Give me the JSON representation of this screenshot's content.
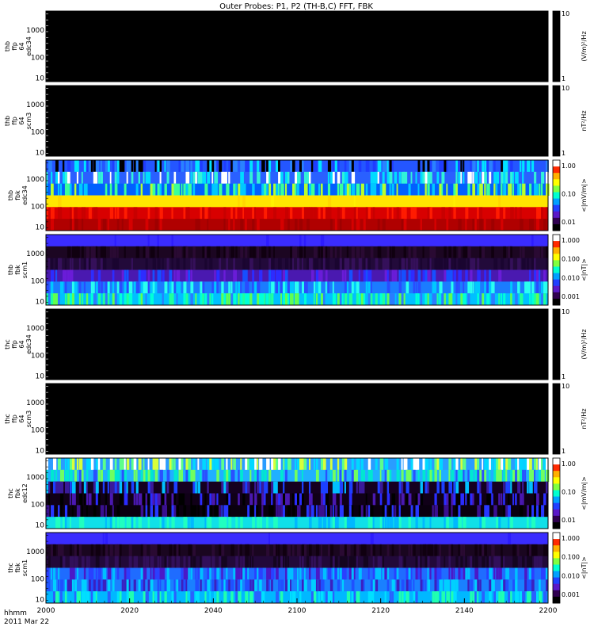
{
  "chart_data": {
    "type": "heatmap",
    "title": "Outer Probes: P1, P2 (TH-B,C) FFT, FBK",
    "xaxis": {
      "header_label": "hhmm",
      "date_label": "2011 Mar 22",
      "ticks": [
        "2000",
        "2020",
        "2040",
        "2100",
        "2120",
        "2140",
        "2200"
      ]
    },
    "panels": [
      {
        "id": "thb-ffp64-edc34",
        "ylabel": [
          "thb",
          "ffp",
          "64",
          "edc34"
        ],
        "yticks": [
          "1000",
          "100",
          "10"
        ],
        "colorbar_label": "(V/m)²/Hz",
        "colorbar_ticks": [
          "10",
          "1"
        ],
        "colorbar_palette": "black",
        "data_state": "no data (all black)"
      },
      {
        "id": "thb-ffp64-scm3",
        "ylabel": [
          "thb",
          "ffp",
          "64",
          "scm3"
        ],
        "yticks": [
          "1000",
          "100",
          "10"
        ],
        "colorbar_label": "nT²/Hz",
        "colorbar_ticks": [
          "10",
          "1"
        ],
        "colorbar_palette": "black",
        "data_state": "no data (all black)"
      },
      {
        "id": "thb-fbk-edc34",
        "ylabel": [
          "thb",
          "fbk",
          "edc34"
        ],
        "yticks": [
          "1000",
          "100",
          "10"
        ],
        "colorbar_label": "<|mV/m|>",
        "colorbar_ticks": [
          "1.00",
          "0.10",
          "0.01"
        ],
        "colorbar_palette": "rainbow",
        "bands": [
          {
            "base": "#2456ff",
            "vary": [
              "#1f3cff",
              "#00e4ff",
              "#2a82ff",
              "#000000"
            ],
            "density": 0.55
          },
          {
            "base": "#2a60ff",
            "vary": [
              "#00dcff",
              "#31f3d8",
              "#ffffff"
            ],
            "density": 0.5
          },
          {
            "base": "#0060ff",
            "vary": [
              "#00c8ff",
              "#3aff9a",
              "#b5ff2f"
            ],
            "density": 0.5
          },
          {
            "base": "#ffe600",
            "vary": [
              "#fff000",
              "#ffd800"
            ],
            "density": 0.05
          },
          {
            "base": "#d80000",
            "vary": [
              "#ff1b00",
              "#c80000"
            ],
            "density": 0.35
          },
          {
            "base": "#b00000",
            "vary": [
              "#d60000",
              "#9e0000"
            ],
            "density": 0.25
          }
        ]
      },
      {
        "id": "thb-fbk-scm1",
        "ylabel": [
          "thb",
          "fbk",
          "scm1"
        ],
        "yticks": [
          "1000",
          "100",
          "10"
        ],
        "colorbar_label": "<|nT|>",
        "colorbar_ticks": [
          "1.000",
          "0.100",
          "0.010",
          "0.001"
        ],
        "colorbar_palette": "rainbow",
        "bands": [
          {
            "base": "#3a2cff",
            "vary": [
              "#2d1cff"
            ],
            "density": 0.05
          },
          {
            "base": "#1c0622",
            "vary": [
              "#2a0a33",
              "#100010"
            ],
            "density": 0.5
          },
          {
            "base": "#220a3a",
            "vary": [
              "#1a0530",
              "#35105a"
            ],
            "density": 0.5
          },
          {
            "base": "#4a19b0",
            "vary": [
              "#2d2cff",
              "#6a1cd8",
              "#1650ff"
            ],
            "density": 0.45
          },
          {
            "base": "#1b7cff",
            "vary": [
              "#00c8ff",
              "#2a4cff",
              "#2afff0"
            ],
            "density": 0.55
          },
          {
            "base": "#00c0ff",
            "vary": [
              "#20ff9c",
              "#60ff50",
              "#00ffd8",
              "#2a7cff"
            ],
            "density": 0.6
          }
        ]
      },
      {
        "id": "thc-ffp64-edc34",
        "ylabel": [
          "thc",
          "ffp",
          "64",
          "edc34"
        ],
        "yticks": [
          "1000",
          "100",
          "10"
        ],
        "colorbar_label": "(V/m)²/Hz",
        "colorbar_ticks": [
          "10",
          "1"
        ],
        "colorbar_palette": "black",
        "data_state": "no data (all black)"
      },
      {
        "id": "thc-ffp64-scm3",
        "ylabel": [
          "thc",
          "ffp",
          "64",
          "scm3"
        ],
        "yticks": [
          "1000",
          "100",
          "10"
        ],
        "colorbar_label": "nT²/Hz",
        "colorbar_ticks": [
          "10",
          "1"
        ],
        "colorbar_palette": "black",
        "data_state": "no data (all black)"
      },
      {
        "id": "thc-fbk-edc12",
        "ylabel": [
          "thc",
          "fbk",
          "edc12"
        ],
        "yticks": [
          "1000",
          "100",
          "10"
        ],
        "colorbar_label": "<|mV/m|>",
        "colorbar_ticks": [
          "1.00",
          "0.10",
          "0.01"
        ],
        "colorbar_palette": "rainbow",
        "bands": [
          {
            "base": "#2a9cff",
            "vary": [
              "#5cff8a",
              "#d8ff3a",
              "#00d8ff",
              "#ffffff"
            ],
            "density": 0.6
          },
          {
            "base": "#20b0ff",
            "vary": [
              "#70ff60",
              "#2a50ff",
              "#00e8d0"
            ],
            "density": 0.6
          },
          {
            "base": "#150020",
            "vary": [
              "#3a1a9a",
              "#1c40ff",
              "#00c0ff"
            ],
            "density": 0.45
          },
          {
            "base": "#100018",
            "vary": [
              "#4a18b0",
              "#2a2cff",
              "#000000"
            ],
            "density": 0.45
          },
          {
            "base": "#0a000f",
            "vary": [
              "#3a1090",
              "#2838ff",
              "#000000"
            ],
            "density": 0.45
          },
          {
            "base": "#10e0e8",
            "vary": [
              "#20ffc0",
              "#00b8ff"
            ],
            "density": 0.35
          }
        ]
      },
      {
        "id": "thc-fbk-scm1",
        "ylabel": [
          "thc",
          "fbk",
          "scm1"
        ],
        "yticks": [
          "1000",
          "100",
          "10"
        ],
        "colorbar_label": "<|nT|>",
        "colorbar_ticks": [
          "1.000",
          "0.100",
          "0.010",
          "0.001"
        ],
        "colorbar_palette": "rainbow",
        "bands": [
          {
            "base": "#3a2cff",
            "vary": [
              "#2d1cff"
            ],
            "density": 0.05
          },
          {
            "base": "#1a0620",
            "vary": [
              "#2a0a33",
              "#100010"
            ],
            "density": 0.5
          },
          {
            "base": "#22093a",
            "vary": [
              "#32105a",
              "#140520"
            ],
            "density": 0.5
          },
          {
            "base": "#1f6cff",
            "vary": [
              "#00c0ff",
              "#4a18c8",
              "#2a40ff"
            ],
            "density": 0.55
          },
          {
            "base": "#1a80ff",
            "vary": [
              "#00d0ff",
              "#3a20c0",
              "#2050ff"
            ],
            "density": 0.55
          },
          {
            "base": "#00b8ff",
            "vary": [
              "#20ffb0",
              "#00e0ff",
              "#2a60ff"
            ],
            "density": 0.55
          }
        ]
      }
    ]
  }
}
